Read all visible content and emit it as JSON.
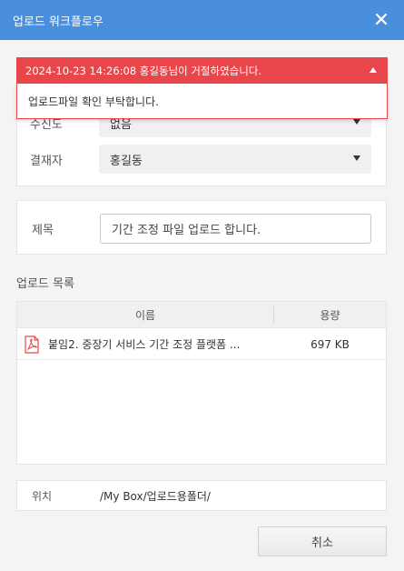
{
  "window": {
    "title": "업로드 워크플로우"
  },
  "alert": {
    "header": "2024-10-23 14:26:08 홍길동님이 거절하였습니다.",
    "message": "업로드파일 확인 부탁합니다.",
    "color": "#e8464b"
  },
  "approval": {
    "receiver_label": "수신도",
    "receiver_value": "없음",
    "approver_label": "결재자",
    "approver_value": "홍길동"
  },
  "subject": {
    "label": "제목",
    "value": "기간 조정 파일 업로드 합니다."
  },
  "upload_list": {
    "title": "업로드 목록",
    "columns": [
      "이름",
      "용량"
    ],
    "files": [
      {
        "icon": "pdf-file-icon",
        "name": "붙임2. 중장기 서비스 기간 조정 플랫폼 ...",
        "size": "697 KB"
      }
    ]
  },
  "location": {
    "label": "위치",
    "value": "/My Box/업로드용폴더/"
  },
  "buttons": {
    "cancel": "취소"
  },
  "colors": {
    "titlebar": "#4a8fdc",
    "alert": "#e8464b"
  }
}
